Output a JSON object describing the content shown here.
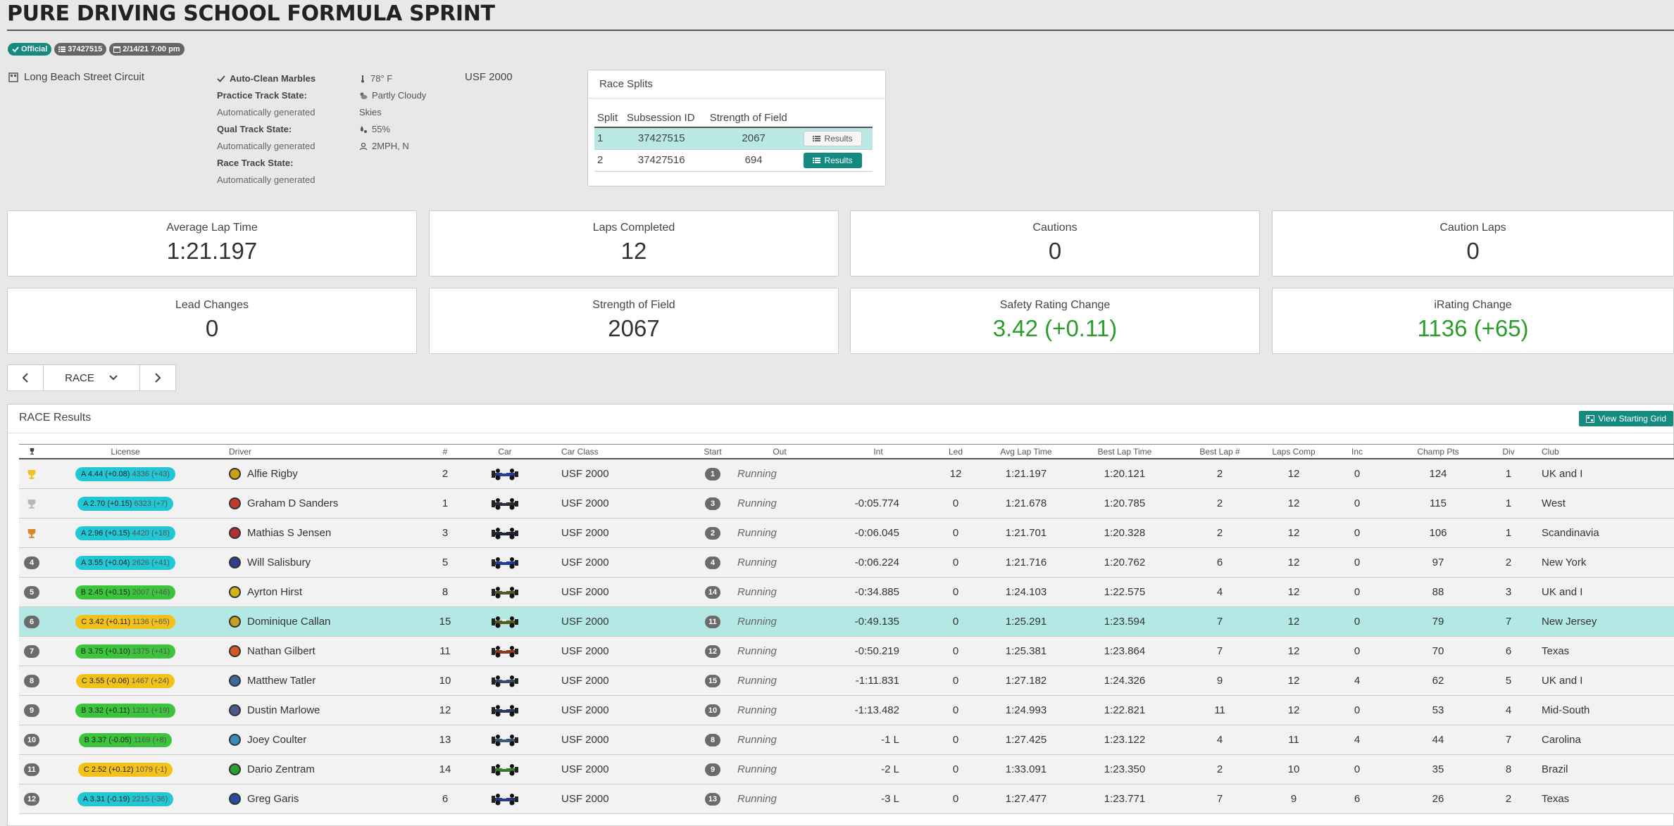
{
  "page": {
    "title": "PURE DRIVING SCHOOL FORMULA SPRINT"
  },
  "badges": {
    "official": "Official",
    "session_id": "37427515",
    "date": "2/14/21 7:00 pm"
  },
  "track": {
    "name": "Long Beach Street Circuit",
    "marbles": "Auto-Clean Marbles",
    "practice_label": "Practice Track State:",
    "practice_value": "Automatically generated",
    "qual_label": "Qual Track State:",
    "qual_value": "Automatically generated",
    "race_label": "Race Track State:",
    "race_value": "Automatically generated"
  },
  "weather": {
    "temp": "78° F",
    "sky": "Partly Cloudy",
    "skies_label": "Skies",
    "humidity": "55%",
    "wind": "2MPH, N"
  },
  "car_class": "USF 2000",
  "splits": {
    "title": "Race Splits",
    "headers": [
      "Split",
      "Subsession ID",
      "Strength of Field"
    ],
    "rows": [
      {
        "split": "1",
        "id": "37427515",
        "sof": "2067",
        "btn": "Results"
      },
      {
        "split": "2",
        "id": "37427516",
        "sof": "694",
        "btn": "Results"
      }
    ]
  },
  "stats": [
    {
      "label": "Average Lap Time",
      "value": "1:21.197"
    },
    {
      "label": "Laps Completed",
      "value": "12"
    },
    {
      "label": "Cautions",
      "value": "0"
    },
    {
      "label": "Caution Laps",
      "value": "0"
    },
    {
      "label": "Lead Changes",
      "value": "0"
    },
    {
      "label": "Strength of Field",
      "value": "2067"
    },
    {
      "label": "Safety Rating Change",
      "value": "3.42 (+0.11)"
    },
    {
      "label": "iRating Change",
      "value": "1136 (+65)"
    }
  ],
  "pager": {
    "session": "RACE"
  },
  "results": {
    "title": "RACE Results",
    "starting_grid_btn": "View Starting Grid",
    "headers": {
      "license": "License",
      "driver": "Driver",
      "num": "#",
      "car": "Car",
      "car_class": "Car Class",
      "start": "Start",
      "out": "Out",
      "int": "Int",
      "led": "Led",
      "avg": "Avg Lap Time",
      "best": "Best Lap Time",
      "best_num": "Best Lap #",
      "laps": "Laps Comp",
      "inc": "Inc",
      "champ": "Champ Pts",
      "div": "Div",
      "club": "Club"
    },
    "colors": {
      "gold": "#f2c21b",
      "silver": "#b8b8b8",
      "bronze": "#d7882b"
    },
    "rows": [
      {
        "pos": "1",
        "trophy": "gold",
        "lic_class": "A",
        "lic": "A 4.44 (+0.08)",
        "ir": "4336 (+43)",
        "driver": "Alfie Rigby",
        "helmet": "#c9a21a",
        "num": "2",
        "car_color": "#2a3f9a",
        "class": "USF 2000",
        "start": "1",
        "out": "Running",
        "int": "",
        "led": "12",
        "avg": "1:21.197",
        "best": "1:20.121",
        "best_num": "2",
        "laps": "12",
        "inc": "0",
        "champ": "124",
        "div": "1",
        "club": "UK and I"
      },
      {
        "pos": "2",
        "trophy": "silver",
        "lic_class": "A",
        "lic": "A 2.70 (+0.15)",
        "ir": "6323 (+7)",
        "driver": "Graham D Sanders",
        "helmet": "#c0392b",
        "num": "1",
        "car_color": "#2b2f3a",
        "class": "USF 2000",
        "start": "3",
        "out": "Running",
        "int": "-0:05.774",
        "led": "0",
        "avg": "1:21.678",
        "best": "1:20.785",
        "best_num": "2",
        "laps": "12",
        "inc": "0",
        "champ": "115",
        "div": "1",
        "club": "West"
      },
      {
        "pos": "3",
        "trophy": "bronze",
        "lic_class": "A",
        "lic": "A 2.96 (+0.15)",
        "ir": "4420 (+18)",
        "driver": "Mathias S Jensen",
        "helmet": "#b03030",
        "num": "3",
        "car_color": "#1d2438",
        "class": "USF 2000",
        "start": "2",
        "out": "Running",
        "int": "-0:06.045",
        "led": "0",
        "avg": "1:21.701",
        "best": "1:20.328",
        "best_num": "2",
        "laps": "12",
        "inc": "0",
        "champ": "106",
        "div": "1",
        "club": "Scandinavia"
      },
      {
        "pos": "4",
        "trophy": "",
        "lic_class": "A",
        "lic": "A 3.55 (+0.04)",
        "ir": "2626 (+41)",
        "driver": "Will Salisbury",
        "helmet": "#2c3e8f",
        "num": "5",
        "car_color": "#1f3f9a",
        "class": "USF 2000",
        "start": "4",
        "out": "Running",
        "int": "-0:06.224",
        "led": "0",
        "avg": "1:21.716",
        "best": "1:20.762",
        "best_num": "6",
        "laps": "12",
        "inc": "0",
        "champ": "97",
        "div": "2",
        "club": "New York"
      },
      {
        "pos": "5",
        "trophy": "",
        "lic_class": "B",
        "lic": "B 2.45 (+0.15)",
        "ir": "2007 (+46)",
        "driver": "Ayrton Hirst",
        "helmet": "#d4b21a",
        "num": "8",
        "car_color": "#4a5a2a",
        "class": "USF 2000",
        "start": "14",
        "out": "Running",
        "int": "-0:34.885",
        "led": "0",
        "avg": "1:24.103",
        "best": "1:22.575",
        "best_num": "4",
        "laps": "12",
        "inc": "0",
        "champ": "88",
        "div": "3",
        "club": "UK and I"
      },
      {
        "pos": "6",
        "trophy": "",
        "lic_class": "C",
        "lic": "C 3.42 (+0.11)",
        "ir": "1136 (+65)",
        "driver": "Dominique Callan",
        "helmet": "#c8a020",
        "num": "15",
        "car_color": "#5a5a1a",
        "class": "USF 2000",
        "start": "11",
        "out": "Running",
        "int": "-0:49.135",
        "led": "0",
        "avg": "1:25.291",
        "best": "1:23.594",
        "best_num": "7",
        "laps": "12",
        "inc": "0",
        "champ": "79",
        "div": "7",
        "club": "New Jersey",
        "highlight": true
      },
      {
        "pos": "7",
        "trophy": "",
        "lic_class": "B",
        "lic": "B 3.75 (+0.10)",
        "ir": "1375 (+41)",
        "driver": "Nathan Gilbert",
        "helmet": "#d05a20",
        "num": "11",
        "car_color": "#8a3a1a",
        "class": "USF 2000",
        "start": "12",
        "out": "Running",
        "int": "-0:50.219",
        "led": "0",
        "avg": "1:25.381",
        "best": "1:23.864",
        "best_num": "7",
        "laps": "12",
        "inc": "0",
        "champ": "70",
        "div": "6",
        "club": "Texas"
      },
      {
        "pos": "8",
        "trophy": "",
        "lic_class": "C",
        "lic": "C 3.55 (-0.06)",
        "ir": "1467 (+24)",
        "driver": "Matthew Tatler",
        "helmet": "#3a6a9a",
        "num": "10",
        "car_color": "#3a4a6a",
        "class": "USF 2000",
        "start": "15",
        "out": "Running",
        "int": "-1:11.831",
        "led": "0",
        "avg": "1:27.182",
        "best": "1:24.326",
        "best_num": "9",
        "laps": "12",
        "inc": "4",
        "champ": "62",
        "div": "5",
        "club": "UK and I"
      },
      {
        "pos": "9",
        "trophy": "",
        "lic_class": "B",
        "lic": "B 3.32 (+0.11)",
        "ir": "1231 (+19)",
        "driver": "Dustin Marlowe",
        "helmet": "#4a5a8a",
        "num": "12",
        "car_color": "#2a3a5a",
        "class": "USF 2000",
        "start": "10",
        "out": "Running",
        "int": "-1:13.482",
        "led": "0",
        "avg": "1:24.993",
        "best": "1:22.821",
        "best_num": "11",
        "laps": "12",
        "inc": "0",
        "champ": "53",
        "div": "4",
        "club": "Mid-South"
      },
      {
        "pos": "10",
        "trophy": "",
        "lic_class": "B",
        "lic": "B 3.37 (-0.05)",
        "ir": "1169 (+8)",
        "driver": "Joey Coulter",
        "helmet": "#3a8ac0",
        "num": "13",
        "car_color": "#3a5a7a",
        "class": "USF 2000",
        "start": "8",
        "out": "Running",
        "int": "-1 L",
        "led": "0",
        "avg": "1:27.425",
        "best": "1:23.122",
        "best_num": "4",
        "laps": "11",
        "inc": "4",
        "champ": "44",
        "div": "7",
        "club": "Carolina"
      },
      {
        "pos": "11",
        "trophy": "",
        "lic_class": "C",
        "lic": "C 2.52 (+0.12)",
        "ir": "1079 (-1)",
        "driver": "Dario Zentram",
        "helmet": "#2aa02a",
        "num": "14",
        "car_color": "#3a7a2a",
        "class": "USF 2000",
        "start": "9",
        "out": "Running",
        "int": "-2 L",
        "led": "0",
        "avg": "1:33.091",
        "best": "1:23.350",
        "best_num": "2",
        "laps": "10",
        "inc": "0",
        "champ": "35",
        "div": "8",
        "club": "Brazil"
      },
      {
        "pos": "12",
        "trophy": "",
        "lic_class": "A",
        "lic": "A 3.31 (-0.19)",
        "ir": "2215 (-36)",
        "driver": "Greg Garis",
        "helmet": "#2a4aa0",
        "num": "6",
        "car_color": "#2a3a8a",
        "class": "USF 2000",
        "start": "13",
        "out": "Running",
        "int": "-3 L",
        "led": "0",
        "avg": "1:27.477",
        "best": "1:23.771",
        "best_num": "7",
        "laps": "9",
        "inc": "6",
        "champ": "26",
        "div": "2",
        "club": "Texas"
      }
    ]
  }
}
